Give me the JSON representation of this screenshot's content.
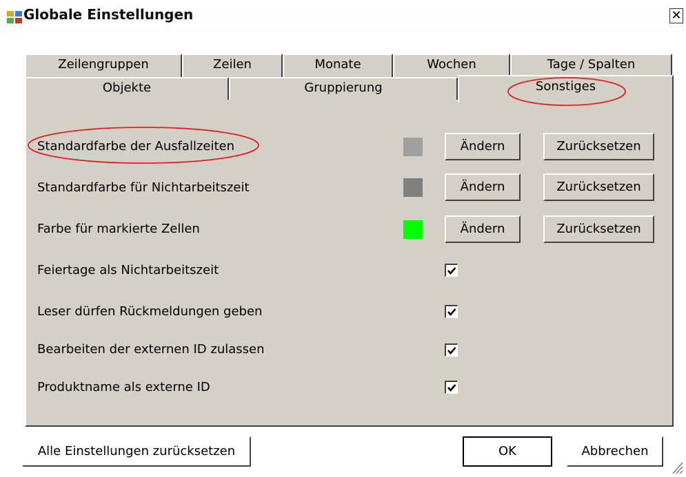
{
  "window": {
    "title": "Globale Einstellungen",
    "close_label": "✕"
  },
  "tabs_row1": [
    "Zeilengruppen",
    "Zeilen",
    "Monate",
    "Wochen",
    "Tage / Spalten"
  ],
  "tabs_row2": [
    "Objekte",
    "Gruppierung",
    "Sonstiges"
  ],
  "active_tab": "Sonstiges",
  "colors": {
    "annotation_ellipse": "#e02020",
    "panel_bg": "#d4d0c8",
    "ausfallzeiten_swatch": "#a0a0a0",
    "nichtarbeitszeit_swatch": "#808080",
    "markiert_swatch": "#00ff00"
  },
  "color_settings": [
    {
      "label": "Standardfarbe der Ausfallzeiten",
      "change_label": "Ändern",
      "reset_label": "Zurücksetzen"
    },
    {
      "label": "Standardfarbe für Nichtarbeitszeit",
      "change_label": "Ändern",
      "reset_label": "Zurücksetzen"
    },
    {
      "label": "Farbe für markierte Zellen",
      "change_label": "Ändern",
      "reset_label": "Zurücksetzen"
    }
  ],
  "checkbox_settings": [
    {
      "label": "Feiertage als Nichtarbeitszeit",
      "checked": true
    },
    {
      "label": "Leser dürfen Rückmeldungen geben",
      "checked": true
    },
    {
      "label": "Bearbeiten der externen ID zulassen",
      "checked": true
    },
    {
      "label": "Produktname als externe ID",
      "checked": true
    }
  ],
  "footer": {
    "reset_all_label": "Alle Einstellungen zurücksetzen",
    "ok_label": "OK",
    "cancel_label": "Abbrechen"
  }
}
